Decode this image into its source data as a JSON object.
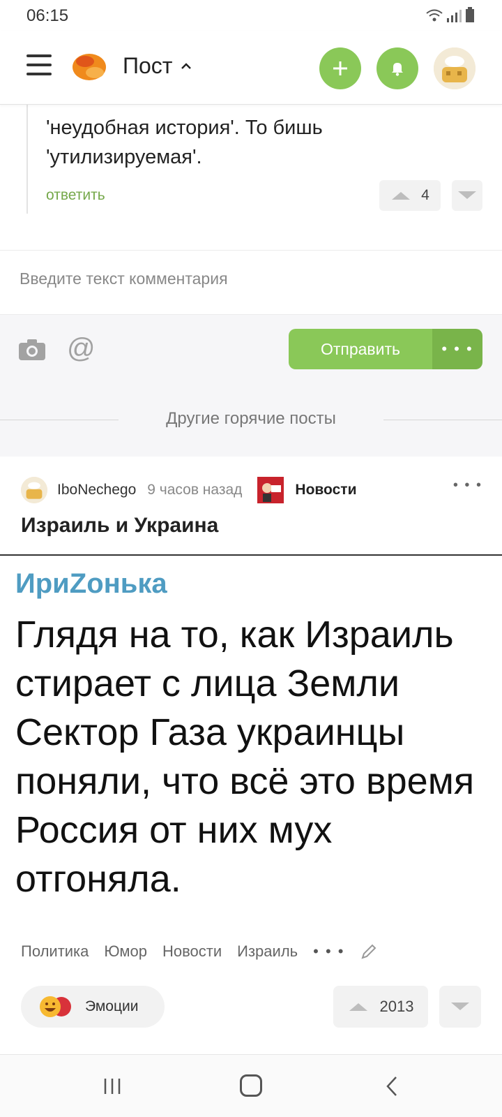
{
  "status_bar": {
    "time": "06:15"
  },
  "header": {
    "title": "Пост",
    "icons": {
      "menu": "hamburger-icon",
      "logo": "pikabu-logo",
      "add": "plus-icon",
      "notifications": "bell-icon",
      "profile": "avatar"
    }
  },
  "comment": {
    "text": "'неудобная история'. То бишь 'утилизируемая'.",
    "reply_label": "ответить",
    "rating": "4"
  },
  "comment_form": {
    "placeholder": "Введите текст комментария",
    "send_label": "Отправить",
    "more_label": "• • •"
  },
  "section_divider": "Другие горячие посты",
  "post": {
    "author": "IboNechego",
    "time": "9 часов назад",
    "community": "Новости",
    "more_label": "• • •",
    "title": "Израиль и Украина",
    "image": {
      "author": "ИриZонька",
      "text": "Глядя на то, как Израиль стирает с лица Земли Сектор Газа украинцы поняли, что всё это время Россия от них мух отгоняла."
    },
    "tags": [
      "Политика",
      "Юмор",
      "Новости",
      "Израиль"
    ],
    "tags_more": "• • •",
    "emotions_label": "Эмоции",
    "rating": "2013"
  },
  "colors": {
    "accent": "#8ac858",
    "accent_dark": "#79b44a",
    "link": "#75a84a",
    "meme_author": "#4f9cc2"
  }
}
